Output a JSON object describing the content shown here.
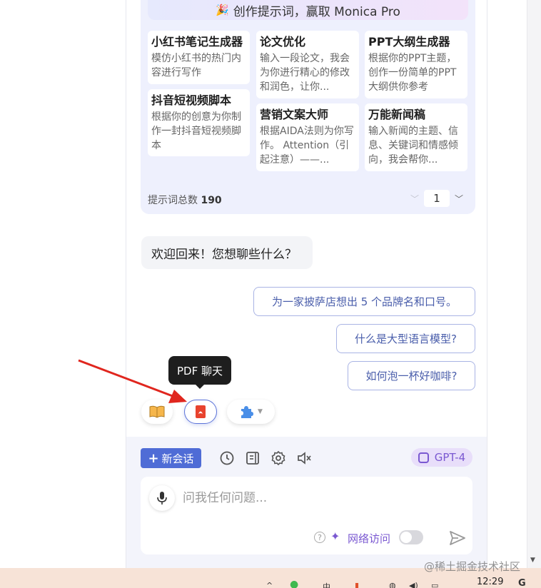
{
  "promo_banner": {
    "icon": "party-popper-icon",
    "text": "创作提示词，赢取 Monica Pro"
  },
  "prompt_tiles": [
    {
      "title": "小红书笔记生成器",
      "desc": "模仿小红书的热门内容进行写作"
    },
    {
      "title": "论文优化",
      "desc": "输入一段论文，我会为你进行精心的修改和润色，让你..."
    },
    {
      "title": "PPT大纲生成器",
      "desc": "根据你的PPT主题，创作一份简单的PPT大纲供你参考"
    },
    {
      "title": "抖音短视频脚本",
      "desc": "根据你的创意为你制作一封抖音短视频脚本"
    },
    {
      "title": "营销文案大师",
      "desc": "根据AIDA法则为你写作。 Attention（引起注意）——..."
    },
    {
      "title": "万能新闻稿",
      "desc": "输入新闻的主题、信息、关键词和情感倾向，我会帮你..."
    }
  ],
  "prompt_count": {
    "label": "提示词总数",
    "value": "190"
  },
  "pager": {
    "current_page": "1"
  },
  "chat": {
    "welcome": "欢迎回来！您想聊些什么？",
    "suggestions": [
      "为一家披萨店想出 5 个品牌名和口号。",
      "什么是大型语言模型?",
      "如何泡一杯好咖啡?"
    ]
  },
  "tooltip": {
    "text": "PDF 聊天"
  },
  "tools": {
    "items": [
      "book-icon",
      "pdf-icon",
      "puzzle-icon"
    ]
  },
  "toolbar": {
    "new_chat_label": "新会话",
    "icons": [
      "history-icon",
      "notes-icon",
      "settings-icon",
      "mute-icon"
    ],
    "model": "GPT-4"
  },
  "input": {
    "placeholder": "问我任何问题...",
    "value": ""
  },
  "web_access": {
    "label": "网络访问",
    "enabled": false
  },
  "taskbar": {
    "time": "12:29"
  },
  "watermark": "@稀土掘金技术社区",
  "colors": {
    "accent": "#4f6cd6",
    "model": "#7a58d1",
    "arrow": "#e0261e",
    "suggest_border": "#a9b4e4"
  }
}
